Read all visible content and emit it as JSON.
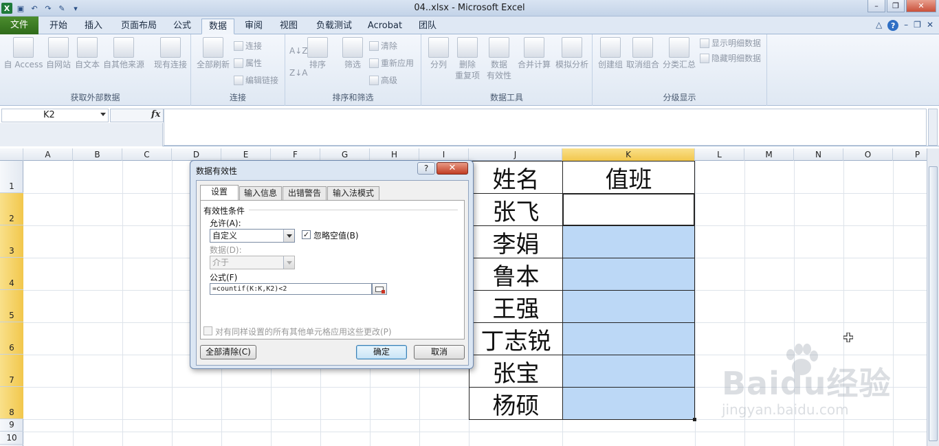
{
  "window": {
    "title": "04..xlsx  -  Microsoft Excel",
    "app_icon": "X"
  },
  "ribbon_tabs": [
    {
      "label": "文件",
      "x": 0
    },
    {
      "label": "开始"
    },
    {
      "label": "插入"
    },
    {
      "label": "页面布局"
    },
    {
      "label": "公式"
    },
    {
      "label": "数据"
    },
    {
      "label": "审阅"
    },
    {
      "label": "视图"
    },
    {
      "label": "负载测试"
    },
    {
      "label": "Acrobat"
    },
    {
      "label": "团队"
    }
  ],
  "ribbon": {
    "groups": [
      {
        "name": "获取外部数据",
        "buttons": [
          "自 Access",
          "自网站",
          "自文本",
          "自其他来源",
          "现有连接"
        ]
      },
      {
        "name": "连接",
        "buttons": [
          "全部刷新"
        ],
        "small": [
          "连接",
          "属性",
          "编辑链接"
        ]
      },
      {
        "name": "排序和筛选",
        "buttons": [
          "排序",
          "筛选"
        ],
        "small": [
          "清除",
          "重新应用",
          "高级"
        ]
      },
      {
        "name": "数据工具",
        "buttons": [
          "分列",
          "删除\n重复项",
          "数据\n有效性",
          "合并计算",
          "模拟分析"
        ]
      },
      {
        "name": "分级显示",
        "buttons": [
          "创建组",
          "取消组合",
          "分类汇总"
        ],
        "small": [
          "显示明细数据",
          "隐藏明细数据"
        ]
      }
    ]
  },
  "formula_bar": {
    "name_box": "K2",
    "fx_symbol": "fx",
    "formula": ""
  },
  "grid": {
    "columns": [
      "A",
      "B",
      "C",
      "D",
      "E",
      "F",
      "G",
      "H",
      "I",
      "J",
      "K",
      "L",
      "M",
      "N",
      "O",
      "P"
    ],
    "selected_column": "K",
    "rows": [
      "1",
      "2",
      "3",
      "4",
      "5",
      "6",
      "7",
      "8",
      "9",
      "10"
    ],
    "selected_rows": [
      "2",
      "3",
      "4",
      "5",
      "6",
      "7",
      "8"
    ],
    "table": {
      "header_name": "姓名",
      "header_duty": "值班",
      "names": [
        "张飞",
        "李娟",
        "鲁本",
        "王强",
        "丁志锐",
        "张宝",
        "杨硕"
      ]
    }
  },
  "dialog": {
    "title": "数据有效性",
    "help": "?",
    "close": "✕",
    "tabs": [
      "设置",
      "输入信息",
      "出错警告",
      "输入法模式"
    ],
    "section_label": "有效性条件",
    "allow_label": "允许(A):",
    "allow_value": "自定义",
    "ignore_blank_label": "忽略空值(B)",
    "ignore_blank_checked": "✓",
    "data_label": "数据(D):",
    "data_value": "介于",
    "formula_label": "公式(F)",
    "formula_value": "=countif(K:K,K2)<2",
    "apply_all_label": "对有同样设置的所有其他单元格应用这些更改(P)",
    "clear_all": "全部清除(C)",
    "ok": "确定",
    "cancel": "取消"
  },
  "watermark": {
    "brand": "Baidu经验",
    "url": "jingyan.baidu.com"
  }
}
